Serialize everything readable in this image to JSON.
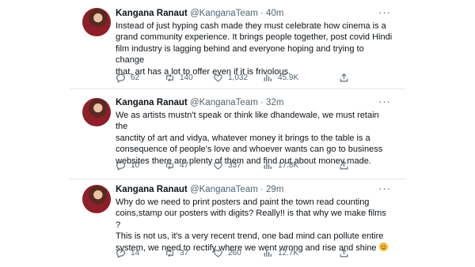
{
  "tweets": [
    {
      "name": "Kangana Ranaut",
      "handle": "@KanganaTeam",
      "time": "· 40m",
      "text": "Instead of just hyping cash made they must celebrate how cinema is a\ngrand community experience. It brings people together, post covid Hindi\nfilm industry is lagging behind and everyone hoping and trying to change\nthat, art has a lot to offer even if it is frivolous.",
      "replies": "62",
      "retweets": "140",
      "likes": "1,032",
      "views": "45.9K"
    },
    {
      "name": "Kangana Ranaut",
      "handle": "@KanganaTeam",
      "time": "· 32m",
      "text": "We as artists mustn't speak or think like dhandewale, we must retain the\nsanctity of art and vidya, whatever money it brings to the table is a\nconsequence of people's love and whoever wants can go to business\nwebsites there are plenty of them and find out about money made.",
      "replies": "10",
      "retweets": "47",
      "likes": "337",
      "views": "17.8K"
    },
    {
      "name": "Kangana Ranaut",
      "handle": "@KanganaTeam",
      "time": "· 29m",
      "text": "Why do we need to print posters and paint the town read counting\ncoins,stamp our posters with digits? Really!! is that why we make films ?\nThis is not us, it's a very recent trend, one bad mind can pollute entire\nsystem, we need to rectify where we went wrong and rise and shine",
      "replies": "14",
      "retweets": "37",
      "likes": "260",
      "views": "12.7K"
    }
  ],
  "more_glyph": "···",
  "icons": {
    "reply": "reply-icon",
    "retweet": "retweet-icon",
    "like": "like-icon",
    "views": "views-icon",
    "share": "share-icon",
    "emoji": "smiling-face-emoji"
  },
  "colors": {
    "text": "#0f1419",
    "muted": "#536471",
    "separator": "#e7e7e7"
  }
}
